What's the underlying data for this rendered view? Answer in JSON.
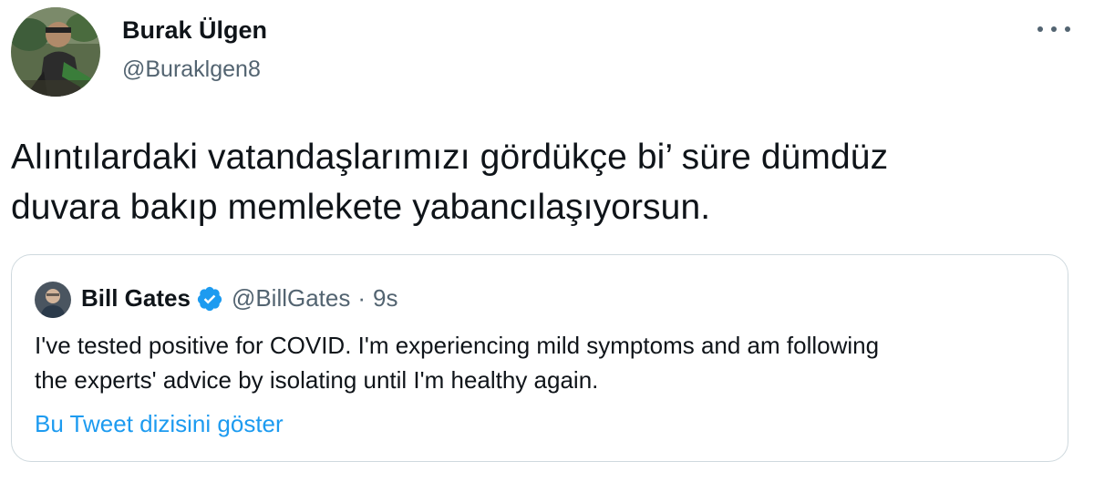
{
  "author": {
    "display_name": "Burak Ülgen",
    "handle": "@Buraklgen8",
    "avatar_icon": "profile-photo"
  },
  "more_icon": "more-options-icon",
  "tweet_text": "Alıntılardaki vatandaşlarımızı gördükçe bi’ süre dümdüz\nduvara bakıp memlekete yabancılaşıyorsun.",
  "quoted_tweet": {
    "display_name": "Bill Gates",
    "verified": true,
    "handle": "@BillGates",
    "separator": "·",
    "time": "9s",
    "text": "I've tested positive for COVID. I'm experiencing mild symptoms and am following\nthe experts' advice by isolating until I'm healthy again.",
    "show_thread_label": "Bu Tweet dizisini göster"
  },
  "colors": {
    "primary_text": "#0f1419",
    "secondary_text": "#536471",
    "link": "#1d9bf0",
    "border": "#cfd9de"
  }
}
